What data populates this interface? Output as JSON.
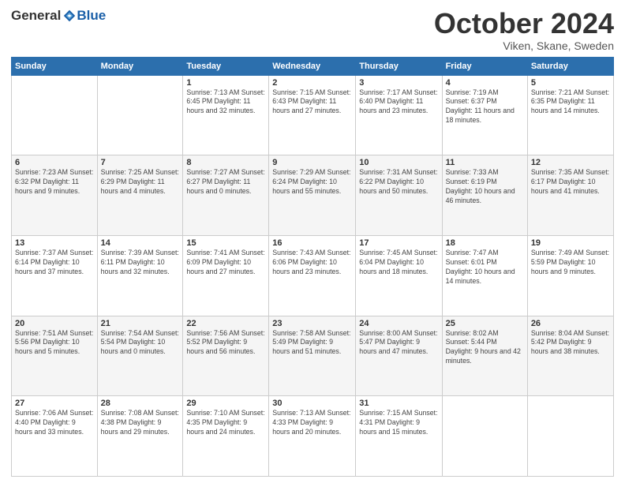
{
  "header": {
    "logo_general": "General",
    "logo_blue": "Blue",
    "month_title": "October 2024",
    "location": "Viken, Skane, Sweden"
  },
  "weekdays": [
    "Sunday",
    "Monday",
    "Tuesday",
    "Wednesday",
    "Thursday",
    "Friday",
    "Saturday"
  ],
  "weeks": [
    [
      {
        "day": "",
        "info": ""
      },
      {
        "day": "",
        "info": ""
      },
      {
        "day": "1",
        "info": "Sunrise: 7:13 AM\nSunset: 6:45 PM\nDaylight: 11 hours and 32 minutes."
      },
      {
        "day": "2",
        "info": "Sunrise: 7:15 AM\nSunset: 6:43 PM\nDaylight: 11 hours and 27 minutes."
      },
      {
        "day": "3",
        "info": "Sunrise: 7:17 AM\nSunset: 6:40 PM\nDaylight: 11 hours and 23 minutes."
      },
      {
        "day": "4",
        "info": "Sunrise: 7:19 AM\nSunset: 6:37 PM\nDaylight: 11 hours and 18 minutes."
      },
      {
        "day": "5",
        "info": "Sunrise: 7:21 AM\nSunset: 6:35 PM\nDaylight: 11 hours and 14 minutes."
      }
    ],
    [
      {
        "day": "6",
        "info": "Sunrise: 7:23 AM\nSunset: 6:32 PM\nDaylight: 11 hours and 9 minutes."
      },
      {
        "day": "7",
        "info": "Sunrise: 7:25 AM\nSunset: 6:29 PM\nDaylight: 11 hours and 4 minutes."
      },
      {
        "day": "8",
        "info": "Sunrise: 7:27 AM\nSunset: 6:27 PM\nDaylight: 11 hours and 0 minutes."
      },
      {
        "day": "9",
        "info": "Sunrise: 7:29 AM\nSunset: 6:24 PM\nDaylight: 10 hours and 55 minutes."
      },
      {
        "day": "10",
        "info": "Sunrise: 7:31 AM\nSunset: 6:22 PM\nDaylight: 10 hours and 50 minutes."
      },
      {
        "day": "11",
        "info": "Sunrise: 7:33 AM\nSunset: 6:19 PM\nDaylight: 10 hours and 46 minutes."
      },
      {
        "day": "12",
        "info": "Sunrise: 7:35 AM\nSunset: 6:17 PM\nDaylight: 10 hours and 41 minutes."
      }
    ],
    [
      {
        "day": "13",
        "info": "Sunrise: 7:37 AM\nSunset: 6:14 PM\nDaylight: 10 hours and 37 minutes."
      },
      {
        "day": "14",
        "info": "Sunrise: 7:39 AM\nSunset: 6:11 PM\nDaylight: 10 hours and 32 minutes."
      },
      {
        "day": "15",
        "info": "Sunrise: 7:41 AM\nSunset: 6:09 PM\nDaylight: 10 hours and 27 minutes."
      },
      {
        "day": "16",
        "info": "Sunrise: 7:43 AM\nSunset: 6:06 PM\nDaylight: 10 hours and 23 minutes."
      },
      {
        "day": "17",
        "info": "Sunrise: 7:45 AM\nSunset: 6:04 PM\nDaylight: 10 hours and 18 minutes."
      },
      {
        "day": "18",
        "info": "Sunrise: 7:47 AM\nSunset: 6:01 PM\nDaylight: 10 hours and 14 minutes."
      },
      {
        "day": "19",
        "info": "Sunrise: 7:49 AM\nSunset: 5:59 PM\nDaylight: 10 hours and 9 minutes."
      }
    ],
    [
      {
        "day": "20",
        "info": "Sunrise: 7:51 AM\nSunset: 5:56 PM\nDaylight: 10 hours and 5 minutes."
      },
      {
        "day": "21",
        "info": "Sunrise: 7:54 AM\nSunset: 5:54 PM\nDaylight: 10 hours and 0 minutes."
      },
      {
        "day": "22",
        "info": "Sunrise: 7:56 AM\nSunset: 5:52 PM\nDaylight: 9 hours and 56 minutes."
      },
      {
        "day": "23",
        "info": "Sunrise: 7:58 AM\nSunset: 5:49 PM\nDaylight: 9 hours and 51 minutes."
      },
      {
        "day": "24",
        "info": "Sunrise: 8:00 AM\nSunset: 5:47 PM\nDaylight: 9 hours and 47 minutes."
      },
      {
        "day": "25",
        "info": "Sunrise: 8:02 AM\nSunset: 5:44 PM\nDaylight: 9 hours and 42 minutes."
      },
      {
        "day": "26",
        "info": "Sunrise: 8:04 AM\nSunset: 5:42 PM\nDaylight: 9 hours and 38 minutes."
      }
    ],
    [
      {
        "day": "27",
        "info": "Sunrise: 7:06 AM\nSunset: 4:40 PM\nDaylight: 9 hours and 33 minutes."
      },
      {
        "day": "28",
        "info": "Sunrise: 7:08 AM\nSunset: 4:38 PM\nDaylight: 9 hours and 29 minutes."
      },
      {
        "day": "29",
        "info": "Sunrise: 7:10 AM\nSunset: 4:35 PM\nDaylight: 9 hours and 24 minutes."
      },
      {
        "day": "30",
        "info": "Sunrise: 7:13 AM\nSunset: 4:33 PM\nDaylight: 9 hours and 20 minutes."
      },
      {
        "day": "31",
        "info": "Sunrise: 7:15 AM\nSunset: 4:31 PM\nDaylight: 9 hours and 15 minutes."
      },
      {
        "day": "",
        "info": ""
      },
      {
        "day": "",
        "info": ""
      }
    ]
  ]
}
